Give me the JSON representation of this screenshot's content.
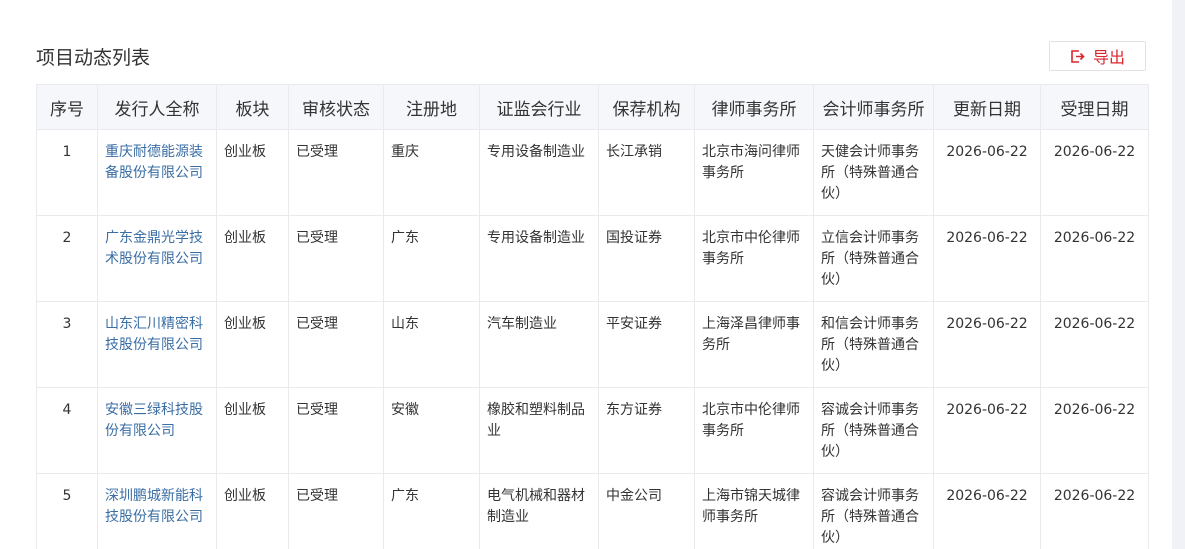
{
  "page": {
    "title": "项目动态列表",
    "export_label": "导出",
    "accent_color": "#d9272e",
    "link_color": "#3a6ea5"
  },
  "table": {
    "headers": [
      "序号",
      "发行人全称",
      "板块",
      "审核状态",
      "注册地",
      "证监会行业",
      "保荐机构",
      "律师事务所",
      "会计师事务所",
      "更新日期",
      "受理日期"
    ],
    "rows": [
      [
        "1",
        "重庆耐德能源装备股份有限公司",
        "创业板",
        "已受理",
        "重庆",
        "专用设备制造业",
        "长江承销",
        "北京市海问律师事务所",
        "天健会计师事务所（特殊普通合伙）",
        "2026-06-22",
        "2026-06-22"
      ],
      [
        "2",
        "广东金鼎光学技术股份有限公司",
        "创业板",
        "已受理",
        "广东",
        "专用设备制造业",
        "国投证券",
        "北京市中伦律师事务所",
        "立信会计师事务所（特殊普通合伙）",
        "2026-06-22",
        "2026-06-22"
      ],
      [
        "3",
        "山东汇川精密科技股份有限公司",
        "创业板",
        "已受理",
        "山东",
        "汽车制造业",
        "平安证券",
        "上海泽昌律师事务所",
        "和信会计师事务所（特殊普通合伙）",
        "2026-06-22",
        "2026-06-22"
      ],
      [
        "4",
        "安徽三绿科技股份有限公司",
        "创业板",
        "已受理",
        "安徽",
        "橡胶和塑料制品业",
        "东方证券",
        "北京市中伦律师事务所",
        "容诚会计师事务所（特殊普通合伙）",
        "2026-06-22",
        "2026-06-22"
      ],
      [
        "5",
        "深圳鹏城新能科技股份有限公司",
        "创业板",
        "已受理",
        "广东",
        "电气机械和器材制造业",
        "中金公司",
        "上海市锦天城律师事务所",
        "容诚会计师事务所（特殊普通合伙）",
        "2026-06-22",
        "2026-06-22"
      ]
    ]
  }
}
